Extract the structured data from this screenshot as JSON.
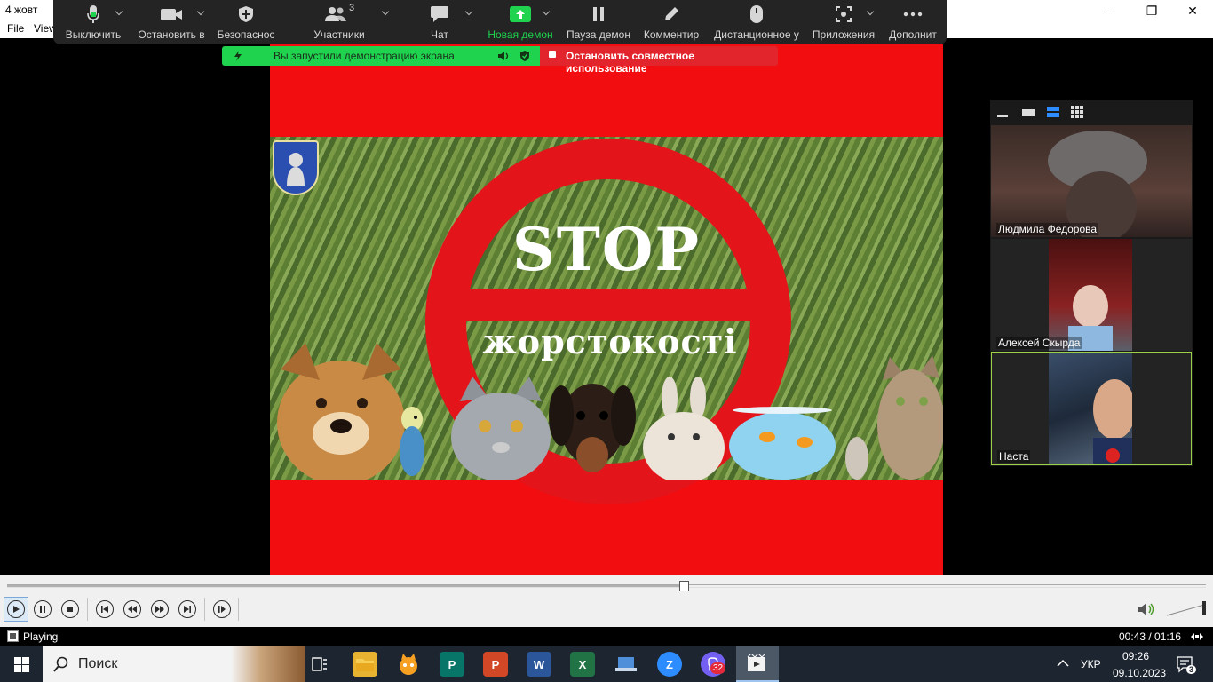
{
  "window": {
    "title": "4 жовт",
    "controls": [
      "–",
      "❐",
      "✕"
    ]
  },
  "menu": {
    "items": [
      "File",
      "View"
    ]
  },
  "zoom_toolbar": {
    "mute": "Выключить",
    "stop_video": "Остановить в",
    "security": "Безопаснос",
    "participants": "Участники",
    "participants_count": "3",
    "chat": "Чат",
    "new_share": "Новая демон",
    "pause_share": "Пауза демон",
    "annotate": "Комментир",
    "remote_control": "Дистанционное у",
    "apps": "Приложения",
    "more": "Дополнит"
  },
  "share_banner": {
    "status": "Вы запустили демонстрацию экрана",
    "stop": "Остановить совместное использование"
  },
  "video": {
    "headline": "STOP",
    "subheadline": "жорстокості"
  },
  "participants_panel": {
    "participants": [
      {
        "name": "Людмила Федорова"
      },
      {
        "name": "Алексей Скырда"
      },
      {
        "name": "Наста"
      }
    ]
  },
  "player": {
    "progress": 0.565,
    "status": "Playing",
    "time": "00:43 / 01:16"
  },
  "taskbar": {
    "search_placeholder": "Поиск",
    "viber_badge": "32",
    "language": "УКР",
    "clock_time": "09:26",
    "clock_date": "09.10.2023",
    "notification_count": "3"
  },
  "colors": {
    "share_green": "#1fd34f",
    "stop_red": "#e2242c",
    "video_red": "#f20d10",
    "active_speaker": "#9bd14a"
  }
}
